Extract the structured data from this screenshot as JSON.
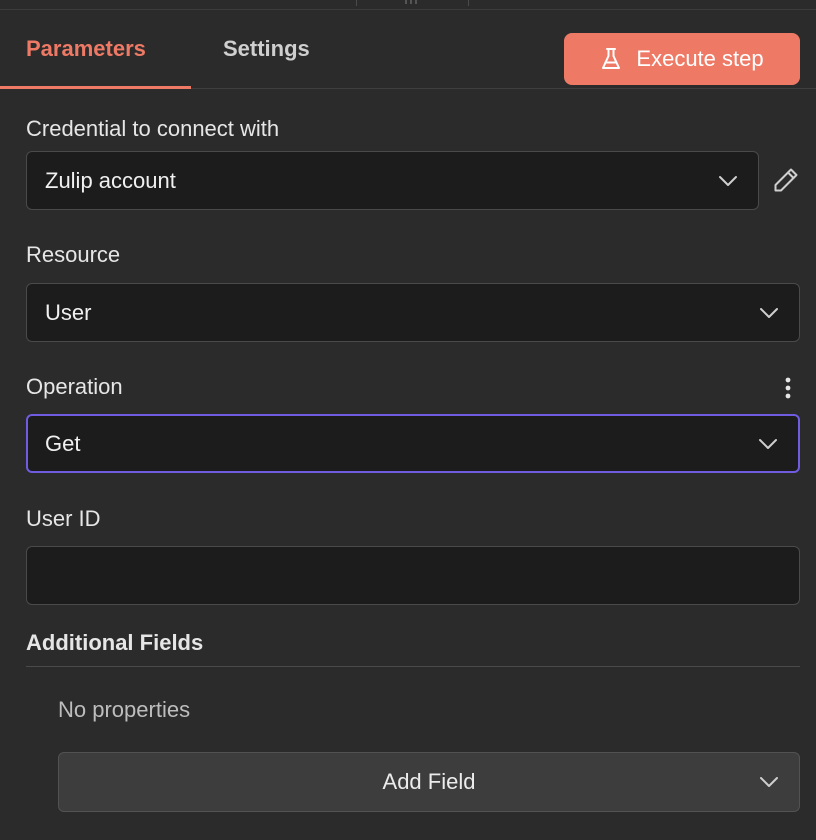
{
  "tabs": {
    "parameters": "Parameters",
    "settings": "Settings"
  },
  "execute_button": "Execute step",
  "credential": {
    "label": "Credential to connect with",
    "value": "Zulip account"
  },
  "resource": {
    "label": "Resource",
    "value": "User"
  },
  "operation": {
    "label": "Operation",
    "value": "Get"
  },
  "user_id": {
    "label": "User ID",
    "value": ""
  },
  "additional_fields": {
    "title": "Additional Fields",
    "empty_text": "No properties",
    "add_button": "Add Field"
  },
  "colors": {
    "accent": "#ee7a66",
    "focus": "#6f5ce0",
    "background": "#2b2b2b"
  }
}
